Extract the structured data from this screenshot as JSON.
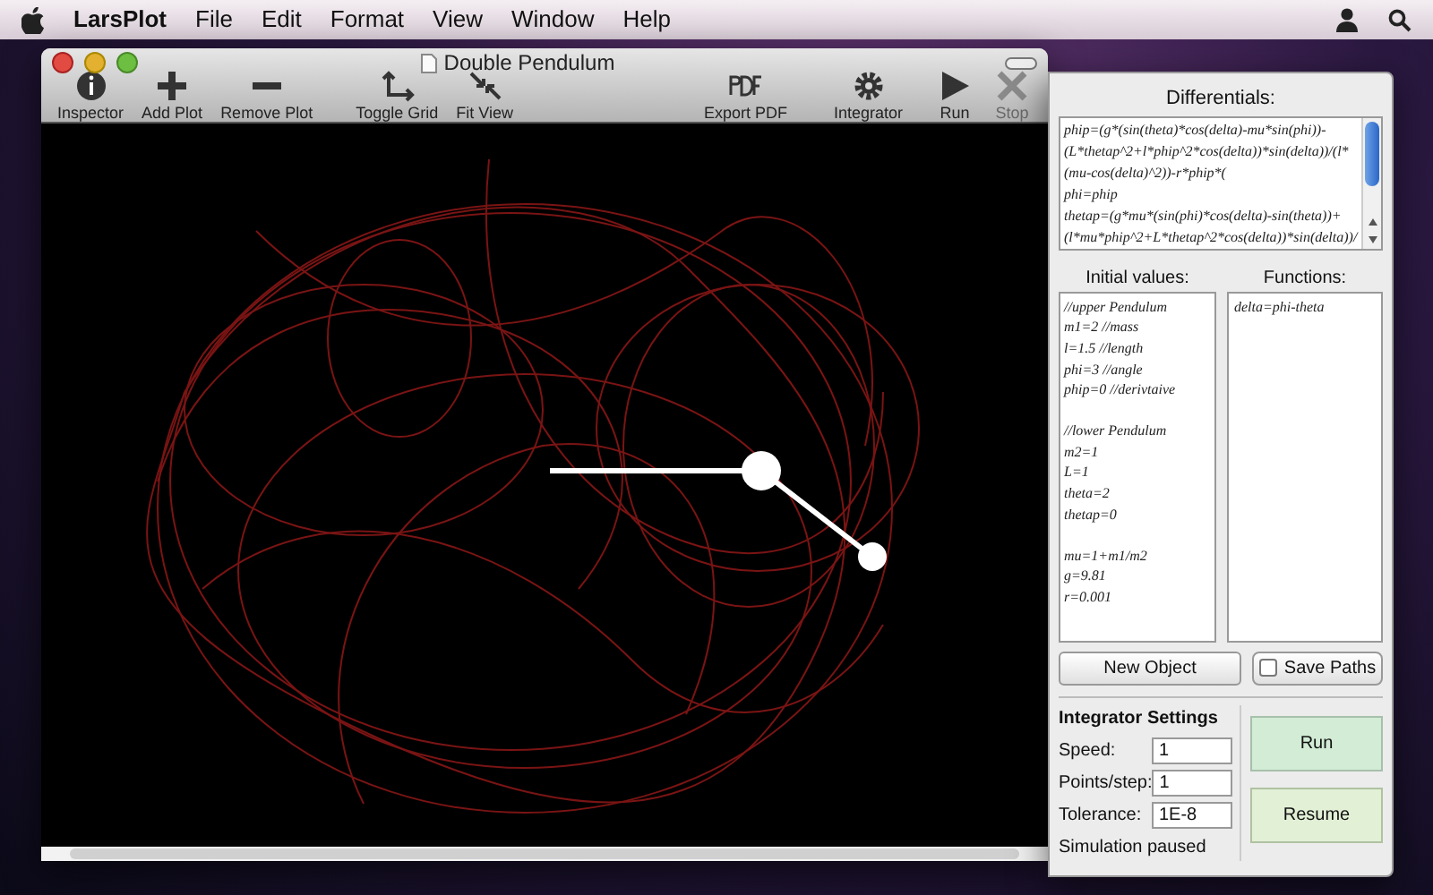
{
  "menu_bar": {
    "app": "LarsPlot",
    "items": [
      "File",
      "Edit",
      "Format",
      "View",
      "Window",
      "Help"
    ]
  },
  "window": {
    "title": "Double Pendulum",
    "toolbar": [
      {
        "label": "Inspector",
        "kind": "info",
        "disabled": false
      },
      {
        "label": "Add Plot",
        "kind": "plus",
        "disabled": false
      },
      {
        "label": "Remove Plot",
        "kind": "minus",
        "disabled": false
      },
      {
        "label": "Toggle Grid",
        "kind": "grid",
        "disabled": false
      },
      {
        "label": "Fit View",
        "kind": "fit",
        "disabled": false
      },
      {
        "label": "Export PDF",
        "kind": "pdf",
        "disabled": false
      },
      {
        "label": "Integrator",
        "kind": "gear",
        "disabled": false
      },
      {
        "label": "Run",
        "kind": "play",
        "disabled": false
      },
      {
        "label": "Stop",
        "kind": "stop",
        "disabled": true
      }
    ]
  },
  "panel": {
    "differentials": {
      "title": "Differentials:",
      "lines": [
        "phip=(g*(sin(theta)*cos(delta)-mu*sin(phi))-",
        "(L*thetap^2+l*phip^2*cos(delta))*sin(delta))/(l*",
        "(mu-cos(delta)^2))-r*phip*(",
        "phi=phip",
        "thetap=(g*mu*(sin(phi)*cos(delta)-sin(theta))+",
        "(l*mu*phip^2+L*thetap^2*cos(delta))*sin(delta))/"
      ]
    },
    "initial_values": {
      "title": "Initial values:",
      "groups": [
        [
          "//upper Pendulum",
          "m1=2 //mass",
          "l=1.5 //length",
          "phi=3 //angle",
          "phip=0 //derivtaive"
        ],
        [
          "//lower Pendulum",
          "m2=1",
          "L=1",
          "theta=2",
          "thetap=0"
        ],
        [
          "mu=1+m1/m2",
          "g=9.81",
          "r=0.001"
        ]
      ]
    },
    "functions": {
      "title": "Functions:",
      "lines": [
        "delta=phi-theta"
      ]
    },
    "new_object_button": "New Object",
    "save_paths": {
      "label": "Save Paths",
      "checked": false
    },
    "integrator_settings": {
      "title": "Integrator Settings",
      "fields": [
        {
          "label": "Speed:",
          "value": "1"
        },
        {
          "label": "Points/step:",
          "value": "1"
        },
        {
          "label": "Tolerance:",
          "value": "1E-8"
        }
      ],
      "status": "Simulation paused"
    },
    "run_button": "Run",
    "resume_button": "Resume"
  }
}
